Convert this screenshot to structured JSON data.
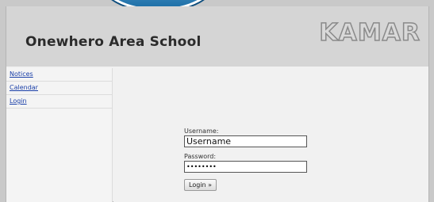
{
  "header": {
    "school_name": "Onewhero Area School",
    "logo_text": "KAMAR"
  },
  "sidebar": {
    "items": [
      {
        "label": "Notices"
      },
      {
        "label": "Calendar"
      },
      {
        "label": "Login"
      }
    ]
  },
  "login": {
    "username_label": "Username:",
    "username_value": "Username",
    "password_label": "Password:",
    "password_value": "••••••••",
    "submit_label": "Login »"
  },
  "colors": {
    "header_bg": "#d5d5d5",
    "link": "#1a3fa8",
    "badge_blue": "#1c6ea6"
  }
}
